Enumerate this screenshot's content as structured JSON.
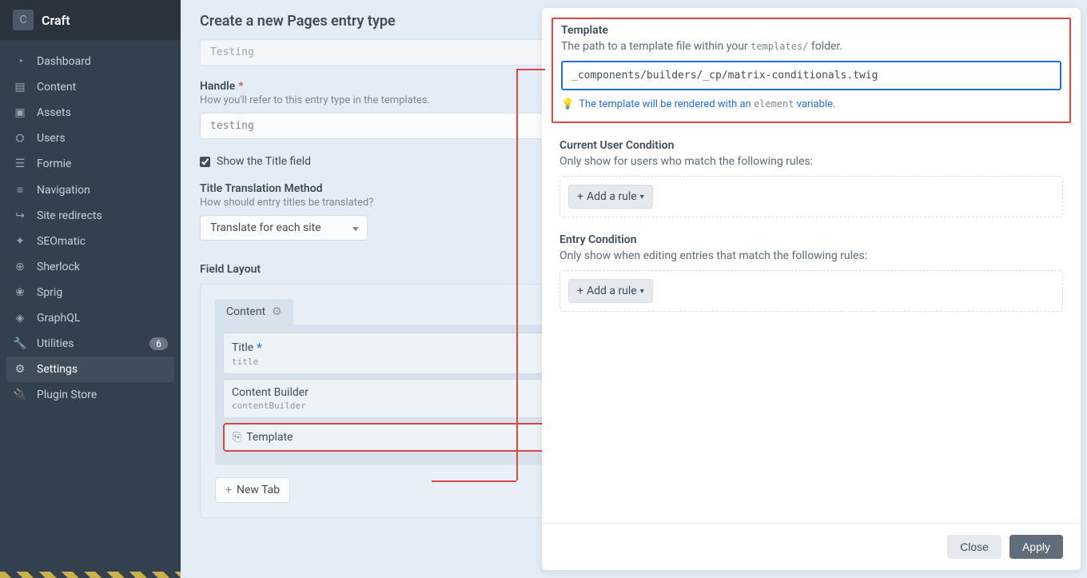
{
  "app": {
    "name": "Craft",
    "logo_letter": "C"
  },
  "sidebar": {
    "items": [
      {
        "label": "Dashboard"
      },
      {
        "label": "Content"
      },
      {
        "label": "Assets"
      },
      {
        "label": "Users"
      },
      {
        "label": "Formie"
      },
      {
        "label": "Navigation"
      },
      {
        "label": "Site redirects"
      },
      {
        "label": "SEOmatic"
      },
      {
        "label": "Sherlock"
      },
      {
        "label": "Sprig"
      },
      {
        "label": "GraphQL"
      },
      {
        "label": "Utilities",
        "badge": "6"
      },
      {
        "label": "Settings"
      },
      {
        "label": "Plugin Store"
      }
    ]
  },
  "page": {
    "title": "Create a new Pages entry type",
    "name_value": "Testing",
    "handle_label": "Handle",
    "handle_desc": "How you'll refer to this entry type in the templates.",
    "handle_value": "testing",
    "show_title_label": "Show the Title field",
    "ttm_label": "Title Translation Method",
    "ttm_desc": "How should entry titles be translated?",
    "ttm_value": "Translate for each site",
    "layout_label": "Field Layout",
    "tab_name": "Content",
    "fields": [
      {
        "name": "Title",
        "handle": "title",
        "required": true
      },
      {
        "name": "Content Builder",
        "handle": "contentBuilder",
        "required": false
      },
      {
        "name": "Template",
        "handle": "",
        "required": false,
        "highlighted": true
      }
    ],
    "new_tab_btn": "New Tab"
  },
  "panel": {
    "template": {
      "label": "Template",
      "desc_pre": "The path to a template file within your ",
      "desc_code": "templates/",
      "desc_post": " folder.",
      "value": "_components/builders/_cp/matrix-conditionals.twig",
      "tip_pre": "The template will be rendered with an ",
      "tip_code": "element",
      "tip_post": " variable."
    },
    "user_cond": {
      "label": "Current User Condition",
      "desc": "Only show for users who match the following rules:",
      "add_rule": "Add a rule"
    },
    "entry_cond": {
      "label": "Entry Condition",
      "desc": "Only show when editing entries that match the following rules:",
      "add_rule": "Add a rule"
    },
    "close": "Close",
    "apply": "Apply"
  }
}
